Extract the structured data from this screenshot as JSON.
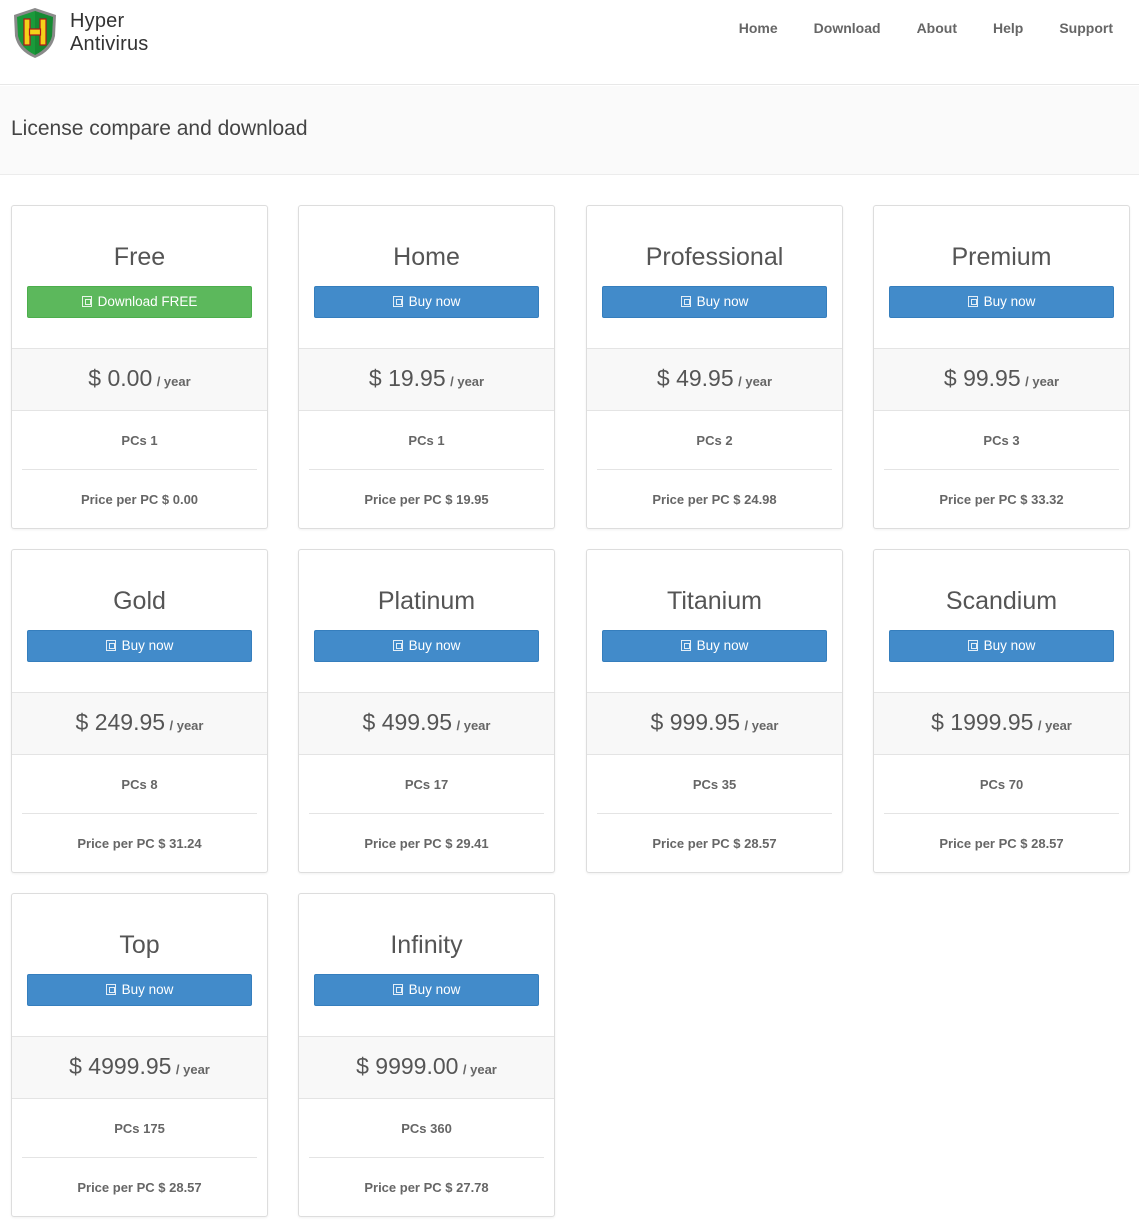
{
  "header": {
    "brand_line1": "Hyper",
    "brand_line2": "Antivirus",
    "logo_letter": "H",
    "nav": [
      "Home",
      "Download",
      "About",
      "Help",
      "Support"
    ]
  },
  "hero": {
    "title": "License compare and download"
  },
  "colors": {
    "primary": "#428bca",
    "success": "#5cb85c",
    "logo_shield": "#1a9a3a",
    "logo_letter": "#f4d21a"
  },
  "icons": {
    "button_icon": "download-icon",
    "logo": "shield-logo-icon"
  },
  "plans": [
    {
      "name": "Free",
      "button": "Download FREE",
      "button_style": "success",
      "price": "$ 0.00",
      "period": "/ year",
      "pcs": "PCs 1",
      "per_pc": "Price per PC $ 0.00"
    },
    {
      "name": "Home",
      "button": "Buy now",
      "button_style": "primary",
      "price": "$ 19.95",
      "period": "/ year",
      "pcs": "PCs 1",
      "per_pc": "Price per PC $ 19.95"
    },
    {
      "name": "Professional",
      "button": "Buy now",
      "button_style": "primary",
      "price": "$ 49.95",
      "period": "/ year",
      "pcs": "PCs 2",
      "per_pc": "Price per PC $ 24.98"
    },
    {
      "name": "Premium",
      "button": "Buy now",
      "button_style": "primary",
      "price": "$ 99.95",
      "period": "/ year",
      "pcs": "PCs 3",
      "per_pc": "Price per PC $ 33.32"
    },
    {
      "name": "Gold",
      "button": "Buy now",
      "button_style": "primary",
      "price": "$ 249.95",
      "period": "/ year",
      "pcs": "PCs 8",
      "per_pc": "Price per PC $ 31.24"
    },
    {
      "name": "Platinum",
      "button": "Buy now",
      "button_style": "primary",
      "price": "$ 499.95",
      "period": "/ year",
      "pcs": "PCs 17",
      "per_pc": "Price per PC $ 29.41"
    },
    {
      "name": "Titanium",
      "button": "Buy now",
      "button_style": "primary",
      "price": "$ 999.95",
      "period": "/ year",
      "pcs": "PCs 35",
      "per_pc": "Price per PC $ 28.57"
    },
    {
      "name": "Scandium",
      "button": "Buy now",
      "button_style": "primary",
      "price": "$ 1999.95",
      "period": "/ year",
      "pcs": "PCs 70",
      "per_pc": "Price per PC $ 28.57"
    },
    {
      "name": "Top",
      "button": "Buy now",
      "button_style": "primary",
      "price": "$ 4999.95",
      "period": "/ year",
      "pcs": "PCs 175",
      "per_pc": "Price per PC $ 28.57"
    },
    {
      "name": "Infinity",
      "button": "Buy now",
      "button_style": "primary",
      "price": "$ 9999.00",
      "period": "/ year",
      "pcs": "PCs 360",
      "per_pc": "Price per PC $ 27.78"
    }
  ]
}
